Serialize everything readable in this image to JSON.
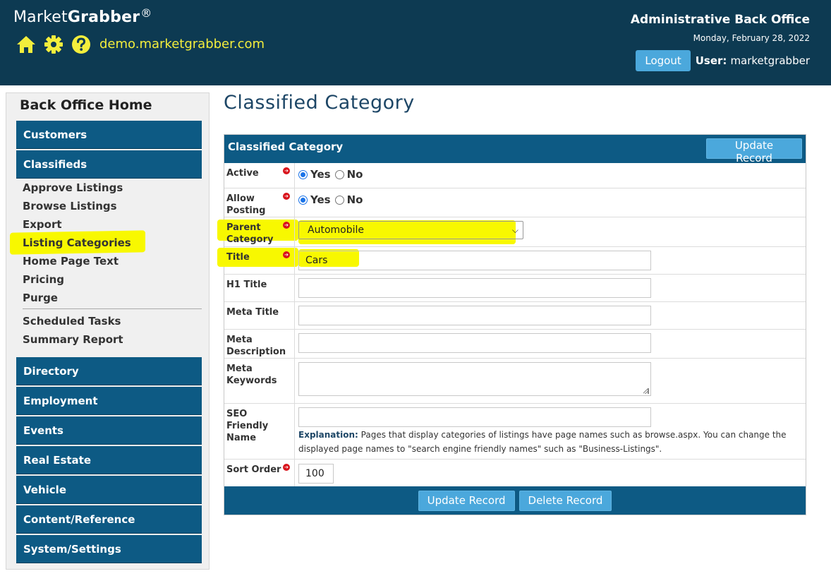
{
  "header": {
    "brand_light": "Market",
    "brand_bold": "Grabber",
    "brand_mark": "®",
    "domain": "demo.marketgrabber.com",
    "title": "Administrative Back Office",
    "date": "Monday, February 28, 2022",
    "logout_label": "Logout",
    "user_label": "User:",
    "user_name": "marketgrabber",
    "icons": [
      "home-icon",
      "gear-icon",
      "help-icon"
    ],
    "icon_color": "#f3ee3c"
  },
  "sidebar": {
    "home": "Back Office Home",
    "sections": {
      "customers": "Customers",
      "classifieds": "Classifieds",
      "directory": "Directory",
      "employment": "Employment",
      "events": "Events",
      "real_estate": "Real Estate",
      "vehicle": "Vehicle",
      "content": "Content/Reference",
      "system": "System/Settings"
    },
    "classifieds_links": [
      "Approve Listings",
      "Browse Listings",
      "Export",
      "Listing Categories",
      "Home Page Text",
      "Pricing",
      "Purge"
    ],
    "classifieds_links_2": [
      "Scheduled Tasks",
      "Summary Report"
    ]
  },
  "main": {
    "page_title": "Classified Category",
    "form_title": "Classified Category",
    "update_label": "Update Record",
    "delete_label": "Delete Record",
    "fields": {
      "active": {
        "label": "Active",
        "yes": "Yes",
        "no": "No",
        "value": "Yes"
      },
      "allow_posting": {
        "label": "Allow Posting",
        "yes": "Yes",
        "no": "No",
        "value": "Yes"
      },
      "parent_category": {
        "label": "Parent Category",
        "value": "Automobile"
      },
      "title": {
        "label": "Title",
        "value": "Cars"
      },
      "h1_title": {
        "label": "H1 Title",
        "value": ""
      },
      "meta_title": {
        "label": "Meta Title",
        "value": ""
      },
      "meta_description": {
        "label": "Meta Description",
        "value": ""
      },
      "meta_keywords": {
        "label": "Meta Keywords",
        "value": ""
      },
      "seo_name": {
        "label": "SEO Friendly Name",
        "value": "",
        "explanation_label": "Explanation:",
        "explanation_text": "Pages that display categories of listings have page names such as browse.aspx. You can change the displayed page names to \"search engine friendly names\" such as \"Business-Listings\"."
      },
      "sort_order": {
        "label": "Sort Order",
        "value": "100"
      }
    }
  },
  "colors": {
    "header_bg": "#0d3a52",
    "nav_bg": "#0d5a84",
    "button_bg": "#4ba8dc",
    "highlight": "#f8f800",
    "required": "#d8141c"
  }
}
